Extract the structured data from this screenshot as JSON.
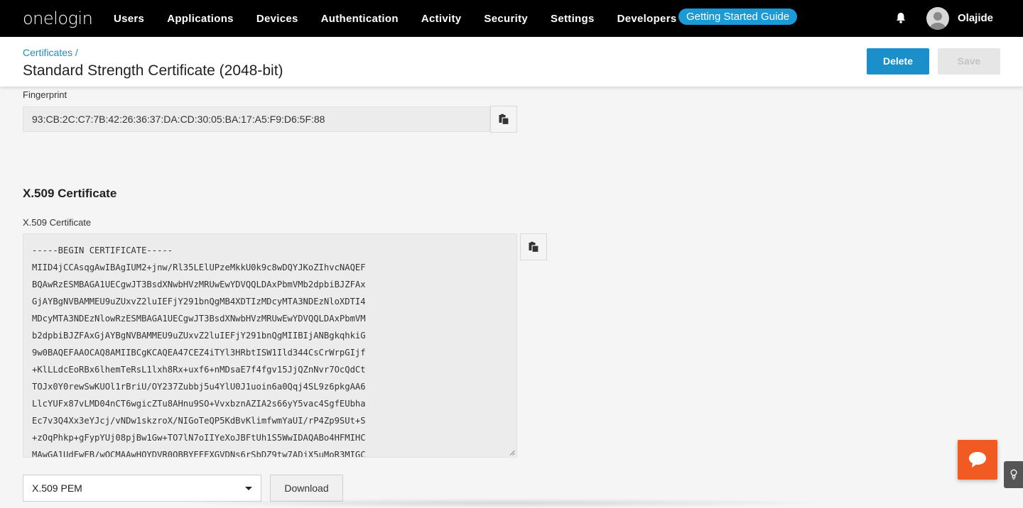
{
  "nav": {
    "logo": "onelogin",
    "items": [
      "Users",
      "Applications",
      "Devices",
      "Authentication",
      "Activity",
      "Security",
      "Settings",
      "Developers"
    ],
    "guide_label": "Getting Started Guide",
    "username": "Olajide"
  },
  "header": {
    "breadcrumb": "Certificates /",
    "title": "Standard Strength Certificate (2048-bit)",
    "delete_label": "Delete",
    "save_label": "Save"
  },
  "fingerprint": {
    "label": "Fingerprint",
    "value": "93:CB:2C:C7:7B:42:26:36:37:DA:CD:30:05:BA:17:A5:F9:D6:5F:88"
  },
  "x509": {
    "section_title": "X.509 Certificate",
    "field_label": "X.509 Certificate",
    "lines": [
      "-----BEGIN CERTIFICATE-----",
      "MIID4jCCAsqgAwIBAgIUM2+jnw/Rl35LElUPzeMkkU0k9c8wDQYJKoZIhvcNAQEF",
      "BQAwRzESMBAGA1UECgwJT3BsdXNwbHVzMRUwEwYDVQQLDAxPbmVMb2dpbiBJZFAx",
      "GjAYBgNVBAMMEU9uZUxvZ2luIEFjY291bnQgMB4XDTIzMDcyMTA3NDEzNloXDTI4",
      "MDcyMTA3NDEzNlowRzESMBAGA1UECgwJT3BsdXNwbHVzMRUwEwYDVQQLDAxPbmVM",
      "b2dpbiBJZFAxGjAYBgNVBAMMEU9uZUxvZ2luIEFjY291bnQgMIIBIjANBgkqhkiG",
      "9w0BAQEFAAOCAQ8AMIIBCgKCAQEA47CEZ4iTYl3HRbtISW1Ild344CsCrWrpGIjf",
      "+KlLLdcEoRBx6lhemTeRsL1lxh8Rx+uxf6+nMDsaE7f4fgv15JjQZnNvr7OcQdCt",
      "TOJx0Y0rewSwKUOl1rBriU/OY237Zubbj5u4YlU0J1uoin6a0Qqj4SL9z6pkgAA6",
      "LlcYUFx87vLMD04nCT6wgicZTu8AHnu9SO+VvxbznAZIA2s66yY5vac4SgfEUbha",
      "Ec7v3Q4Xx3eYJcj/vNDw1skzroX/NIGoTeQP5KdBvKlimfwmYaUI/rP4Zp9SUt+S",
      "+zOqPhkp+gFypYUj08pjBw1Gw+TO7lN7oIIYeXoJBFtUh1S5WwIDAQABo4HFMIHC",
      "MAwGA1UdEwEB/wQCMAAwHQYDVR0OBBYEFEXGVDNs6rSbDZ9tw7ADjX5uMoR3MIGC"
    ]
  },
  "format_select": {
    "value": "X.509 PEM"
  },
  "download_label": "Download"
}
